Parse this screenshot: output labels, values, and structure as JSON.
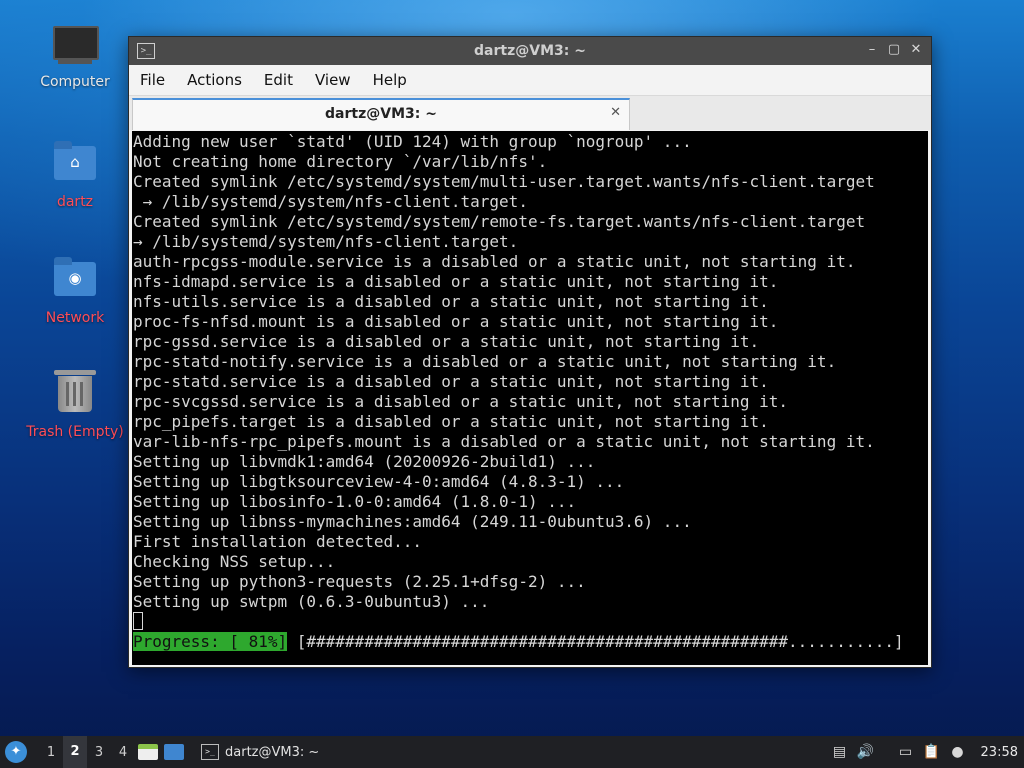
{
  "desktop": {
    "icons": [
      {
        "label": "Computer",
        "icon": "computer-icon"
      },
      {
        "label": "dartz",
        "icon": "home-folder-icon"
      },
      {
        "label": "Network",
        "icon": "network-folder-icon"
      },
      {
        "label": "Trash (Empty)",
        "icon": "trash-icon"
      }
    ]
  },
  "window": {
    "title": "dartz@VM3: ~",
    "menu": [
      "File",
      "Actions",
      "Edit",
      "View",
      "Help"
    ],
    "tab_label": "dartz@VM3: ~",
    "terminal_lines": [
      "Adding new user `statd' (UID 124) with group `nogroup' ...",
      "Not creating home directory `/var/lib/nfs'.",
      "Created symlink /etc/systemd/system/multi-user.target.wants/nfs-client.target",
      " → /lib/systemd/system/nfs-client.target.",
      "Created symlink /etc/systemd/system/remote-fs.target.wants/nfs-client.target",
      "→ /lib/systemd/system/nfs-client.target.",
      "auth-rpcgss-module.service is a disabled or a static unit, not starting it.",
      "nfs-idmapd.service is a disabled or a static unit, not starting it.",
      "nfs-utils.service is a disabled or a static unit, not starting it.",
      "proc-fs-nfsd.mount is a disabled or a static unit, not starting it.",
      "rpc-gssd.service is a disabled or a static unit, not starting it.",
      "rpc-statd-notify.service is a disabled or a static unit, not starting it.",
      "rpc-statd.service is a disabled or a static unit, not starting it.",
      "rpc-svcgssd.service is a disabled or a static unit, not starting it.",
      "rpc_pipefs.target is a disabled or a static unit, not starting it.",
      "var-lib-nfs-rpc_pipefs.mount is a disabled or a static unit, not starting it.",
      "Setting up libvmdk1:amd64 (20200926-2build1) ...",
      "Setting up libgtksourceview-4-0:amd64 (4.8.3-1) ...",
      "Setting up libosinfo-1.0-0:amd64 (1.8.0-1) ...",
      "Setting up libnss-mymachines:amd64 (249.11-0ubuntu3.6) ...",
      "First installation detected...",
      "Checking NSS setup...",
      "Setting up python3-requests (2.25.1+dfsg-2) ...",
      "Setting up swtpm (0.6.3-0ubuntu3) ..."
    ],
    "progress_label": "Progress: [ 81%]",
    "progress_bar": " [##################################################...........]",
    "progress_percent": 81
  },
  "taskbar": {
    "workspaces": [
      "1",
      "2",
      "3",
      "4"
    ],
    "active_workspace": "2",
    "task_label": "dartz@VM3: ~",
    "clock": "23:58"
  },
  "colors": {
    "progress_green": "#2ea82e",
    "desktop_label_red": "#ff4d57"
  }
}
